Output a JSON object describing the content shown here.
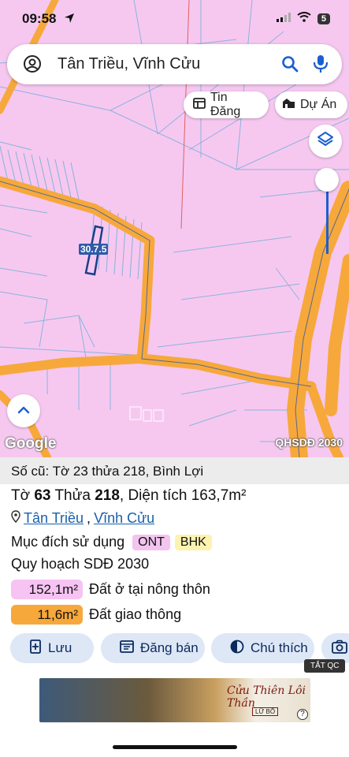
{
  "status": {
    "time": "09:58",
    "battery": "5"
  },
  "search": {
    "query": "Tân Triều, Vĩnh Cửu"
  },
  "chips": {
    "tin_dang": "Tin Đăng",
    "du_an": "Dự Án"
  },
  "map": {
    "parcel_label": "30.7.5",
    "google": "Google",
    "plan_label": "QHSDĐ 2030"
  },
  "info": {
    "old": "Số cũ: Tờ 23 thửa 218, Bình Lợi",
    "to_label": "Tờ",
    "to_value": "63",
    "thua_label": "Thửa",
    "thua_value": "218",
    "area_label": ", Diện tích",
    "area_value": "163,7m²",
    "location_1": "Tân Triều",
    "location_sep": ",",
    "location_2": "Vĩnh Cửu",
    "purpose_label": "Mục đích sử dụng",
    "tag_1": "ONT",
    "tag_2": "BHK",
    "plan_title": "Quy hoạch SDĐ 2030",
    "area_rows": [
      {
        "value": "152,1m²",
        "label": "Đất ở tại nông thôn",
        "color": "#f6c3f2"
      },
      {
        "value": "11,6m²",
        "label": "Đất giao thông",
        "color": "#f7a83b"
      }
    ]
  },
  "actions": {
    "save": "Lưu",
    "sell": "Đăng bán",
    "legend": "Chú thích"
  },
  "ad": {
    "tag": "TẮT QC",
    "title": "Cửu Thiên Lôi Thần",
    "sub": "LỮ BỐ"
  },
  "colors": {
    "land": "#f6c8f0",
    "road": "#f7a83b",
    "accent": "#1a5fd1"
  }
}
